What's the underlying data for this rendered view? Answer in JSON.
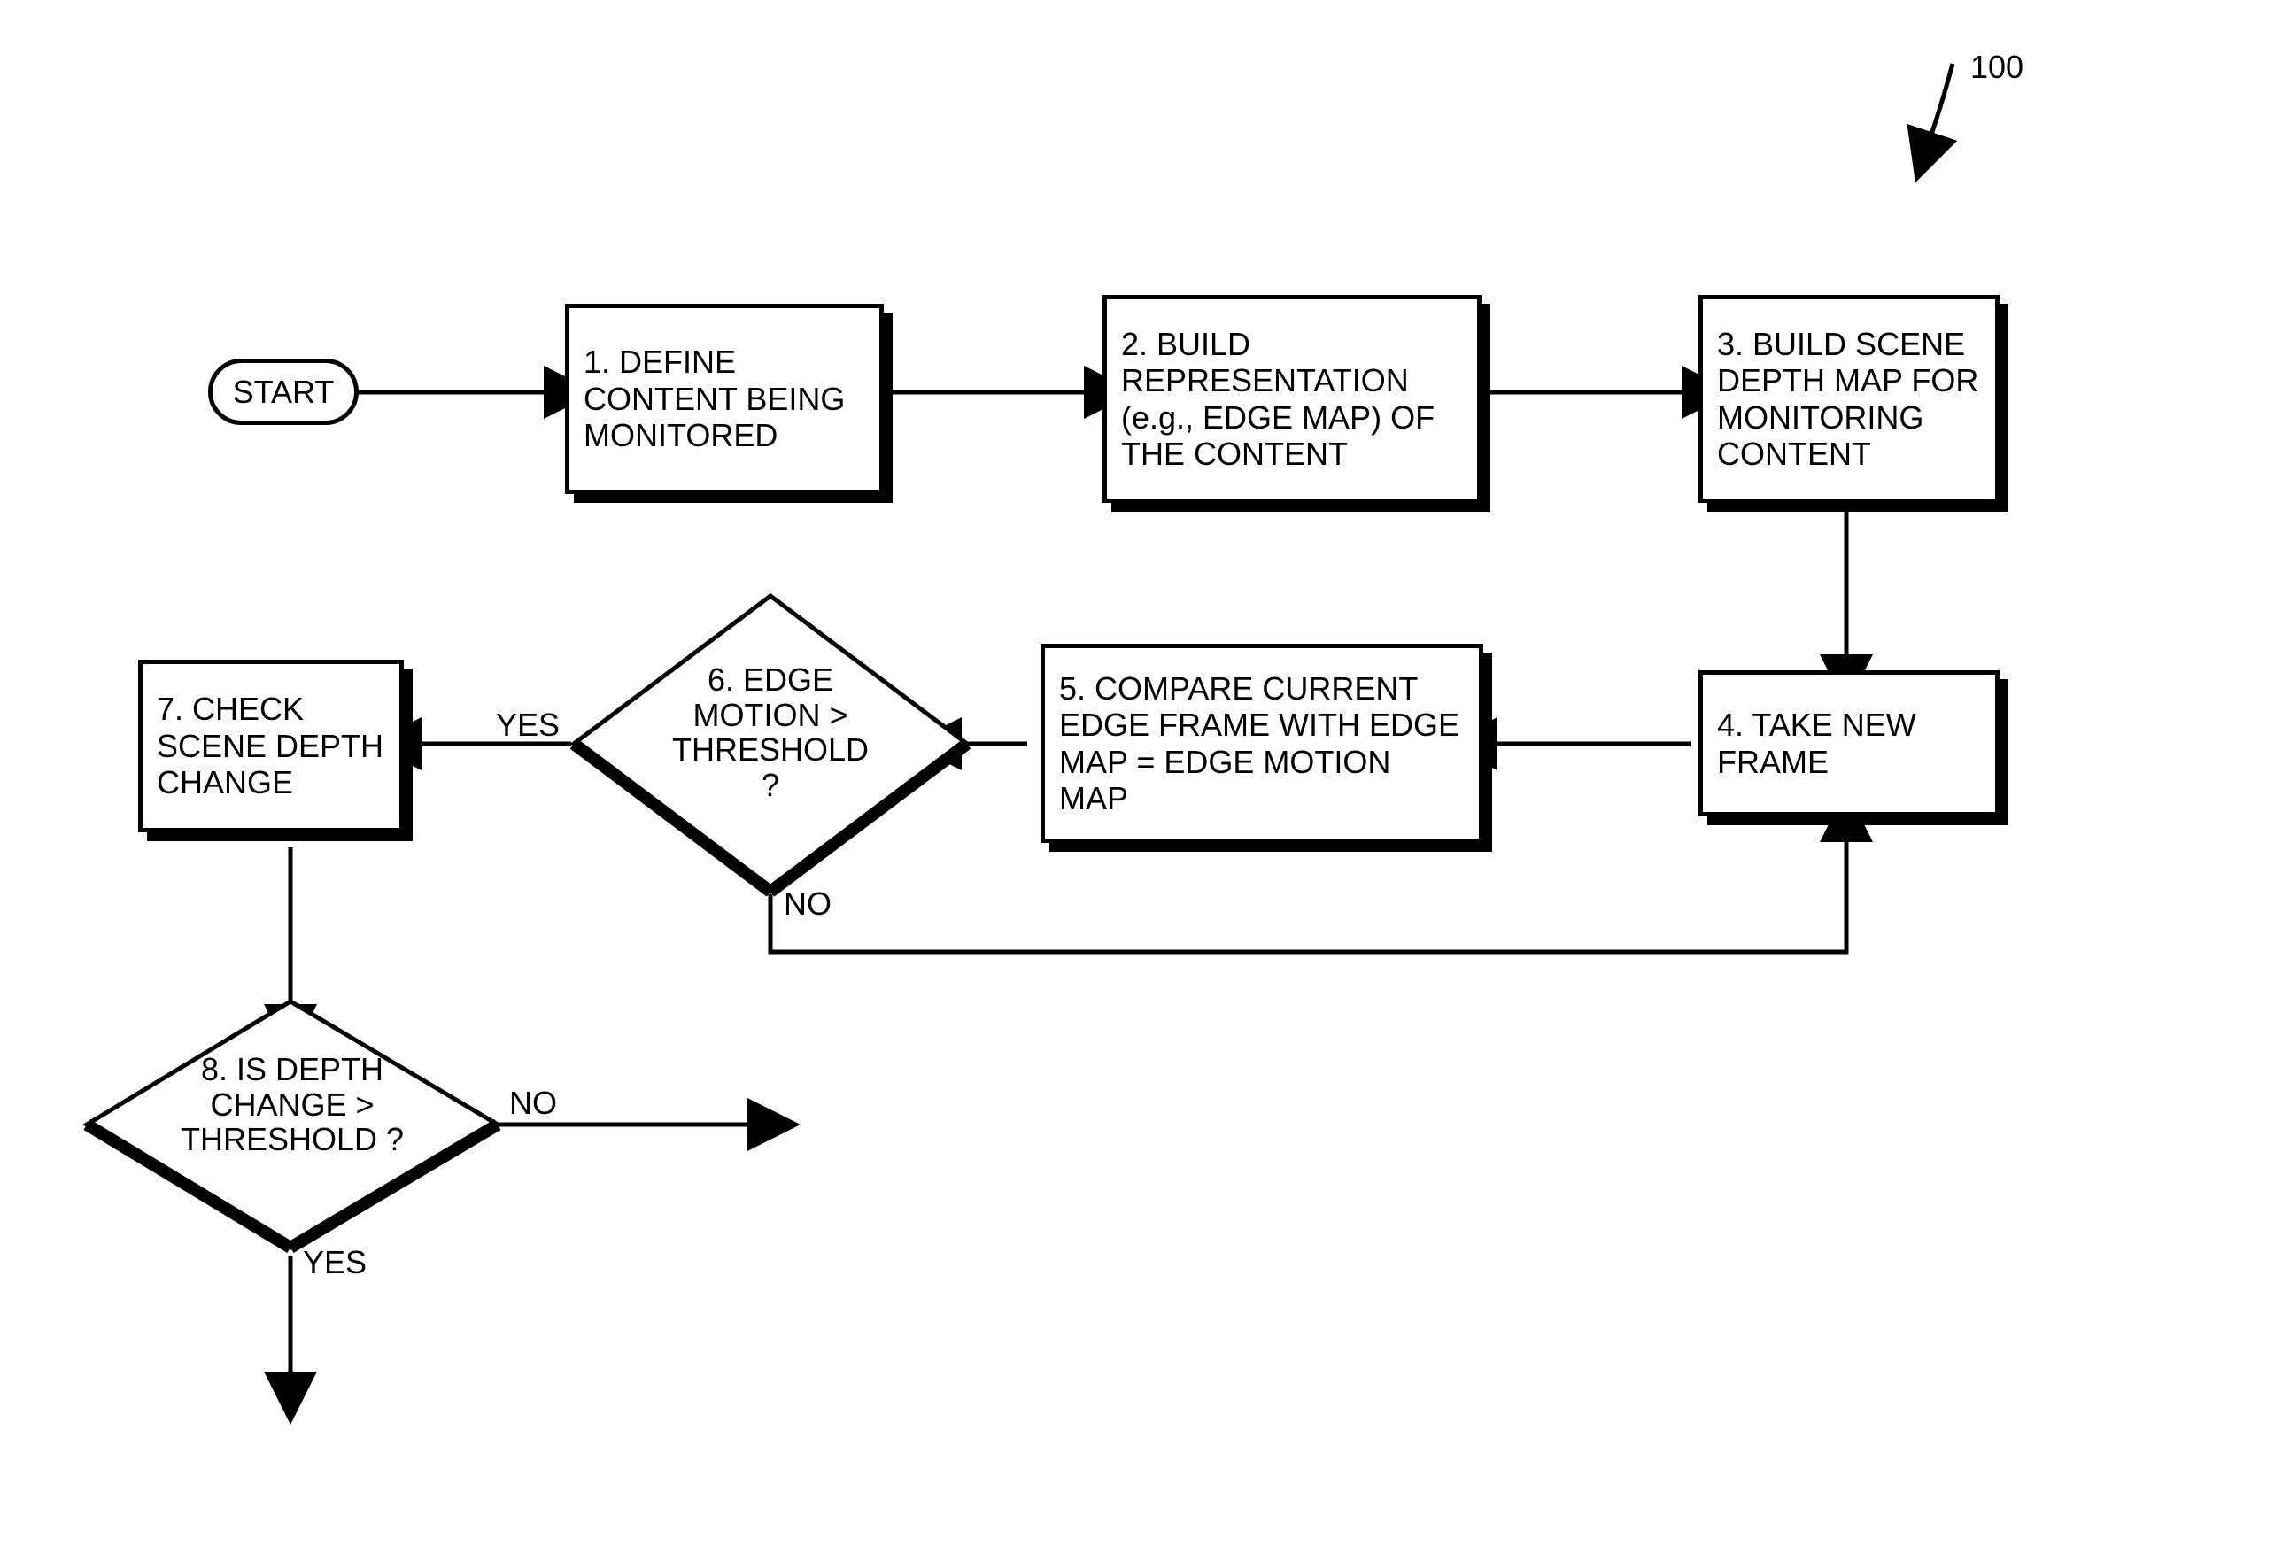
{
  "ref": "100",
  "start": "START",
  "box1": "1. DEFINE CONTENT BEING MONITORED",
  "box2": "2. BUILD REPRESENTATION (e.g., EDGE MAP) OF THE CONTENT",
  "box3": "3. BUILD SCENE DEPTH MAP FOR MONITORING CONTENT",
  "box4": "4. TAKE NEW FRAME",
  "box5": "5. COMPARE CURRENT EDGE FRAME WITH EDGE MAP = EDGE MOTION MAP",
  "diamond6": "6. EDGE MOTION > THRESHOLD ?",
  "box7": "7. CHECK SCENE DEPTH CHANGE",
  "diamond8": "8. IS DEPTH CHANGE > THRESHOLD ?",
  "yes": "YES",
  "no": "NO"
}
